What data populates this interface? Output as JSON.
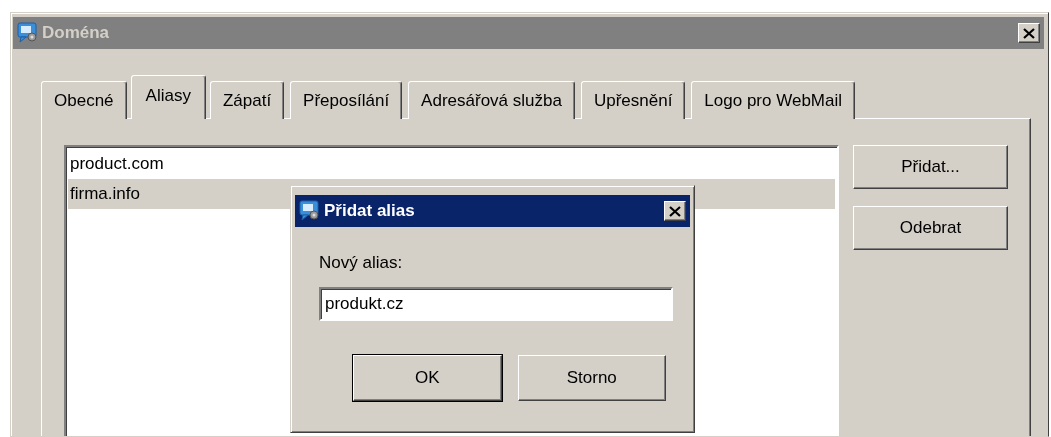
{
  "window": {
    "title": "Doména",
    "active": false
  },
  "tabs": [
    {
      "label": "Obecné",
      "selected": false
    },
    {
      "label": "Aliasy",
      "selected": true
    },
    {
      "label": "Zápatí",
      "selected": false
    },
    {
      "label": "Přeposílání",
      "selected": false
    },
    {
      "label": "Adresářová služba",
      "selected": false
    },
    {
      "label": "Upřesnění",
      "selected": false
    },
    {
      "label": "Logo pro WebMail",
      "selected": false
    }
  ],
  "aliases": [
    {
      "name": "product.com",
      "selected": false
    },
    {
      "name": "firma.info",
      "selected": true
    }
  ],
  "side_buttons": [
    "Přidat...",
    "Odebrat"
  ],
  "dialog": {
    "title": "Přidat alias",
    "active": true,
    "label": "Nový alias:",
    "value": "produkt.cz",
    "buttons": [
      {
        "label": "OK",
        "default": true
      },
      {
        "label": "Storno",
        "default": false
      }
    ]
  }
}
